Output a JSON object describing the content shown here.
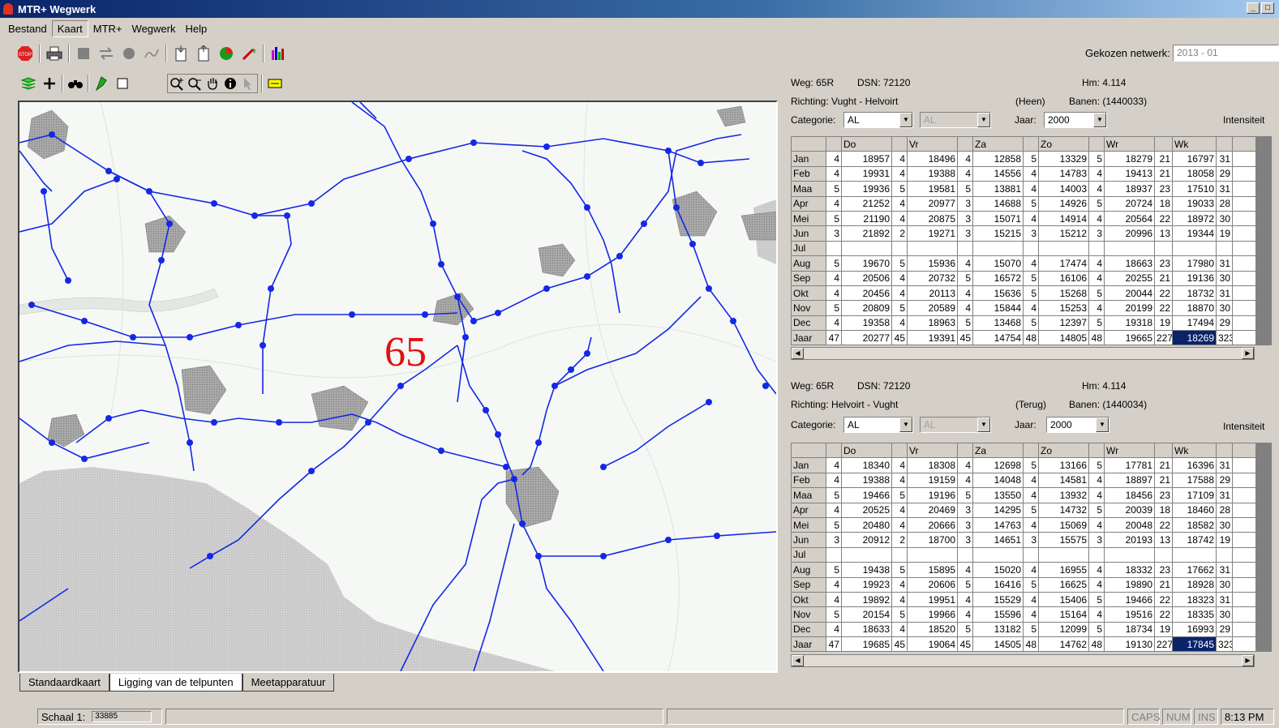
{
  "window": {
    "title": "MTR+ Wegwerk",
    "minimize": "_",
    "restore": "□"
  },
  "menu": [
    "Bestand",
    "Kaart",
    "MTR+",
    "Wegwerk",
    "Help"
  ],
  "toolbar_icons": [
    "stop-icon",
    "print-icon",
    "square-icon",
    "transfer-icon",
    "circle-icon",
    "line-icon",
    "document-in-icon",
    "document-out-icon",
    "pie-chart-icon",
    "wand-icon",
    "bar-chart-icon"
  ],
  "network": {
    "label": "Gekozen netwerk:",
    "value": "2013 - 01"
  },
  "map": {
    "road_label": "65",
    "colors": {
      "road": "#1428e6",
      "town": "#9a9a9a",
      "water": "#e8ece8",
      "region": "#c8c8c8"
    }
  },
  "map_tabs": [
    "Standaardkaart",
    "Ligging van de telpunten",
    "Meetapparatuur"
  ],
  "panel_top": {
    "weg": "Weg: 65R",
    "dsn": "DSN: 72120",
    "hm": "Hm: 4.114",
    "richting": "Richting: Vught - Helvoirt",
    "dir": "(Heen)",
    "banen": "Banen: (1440033)",
    "categorie_label": "Categorie:",
    "categorie": "AL",
    "categorie2": "AL",
    "jaar_label": "Jaar:",
    "jaar": "2000",
    "intensiteit": "Intensiteit",
    "columns": [
      "Do",
      "Vr",
      "Za",
      "Zo",
      "Wr",
      "Wk"
    ],
    "rows": [
      [
        "Jan",
        "4",
        "18957",
        "4",
        "18496",
        "4",
        "12858",
        "5",
        "13329",
        "5",
        "18279",
        "21",
        "16797",
        "31"
      ],
      [
        "Feb",
        "4",
        "19931",
        "4",
        "19388",
        "4",
        "14556",
        "4",
        "14783",
        "4",
        "19413",
        "21",
        "18058",
        "29"
      ],
      [
        "Maa",
        "5",
        "19936",
        "5",
        "19581",
        "5",
        "13881",
        "4",
        "14003",
        "4",
        "18937",
        "23",
        "17510",
        "31"
      ],
      [
        "Apr",
        "4",
        "21252",
        "4",
        "20977",
        "3",
        "14688",
        "5",
        "14926",
        "5",
        "20724",
        "18",
        "19033",
        "28"
      ],
      [
        "Mei",
        "5",
        "21190",
        "4",
        "20875",
        "3",
        "15071",
        "4",
        "14914",
        "4",
        "20564",
        "22",
        "18972",
        "30"
      ],
      [
        "Jun",
        "3",
        "21892",
        "2",
        "19271",
        "3",
        "15215",
        "3",
        "15212",
        "3",
        "20996",
        "13",
        "19344",
        "19"
      ],
      [
        "Jul",
        "",
        "",
        "",
        "",
        "",
        "",
        "",
        "",
        "",
        "",
        "",
        "",
        ""
      ],
      [
        "Aug",
        "5",
        "19670",
        "5",
        "15936",
        "4",
        "15070",
        "4",
        "17474",
        "4",
        "18663",
        "23",
        "17980",
        "31"
      ],
      [
        "Sep",
        "4",
        "20506",
        "4",
        "20732",
        "5",
        "16572",
        "5",
        "16106",
        "4",
        "20255",
        "21",
        "19136",
        "30"
      ],
      [
        "Okt",
        "4",
        "20456",
        "4",
        "20113",
        "4",
        "15636",
        "5",
        "15268",
        "5",
        "20044",
        "22",
        "18732",
        "31"
      ],
      [
        "Nov",
        "5",
        "20809",
        "5",
        "20589",
        "4",
        "15844",
        "4",
        "15253",
        "4",
        "20199",
        "22",
        "18870",
        "30"
      ],
      [
        "Dec",
        "4",
        "19358",
        "4",
        "18963",
        "5",
        "13468",
        "5",
        "12397",
        "5",
        "19318",
        "19",
        "17494",
        "29"
      ],
      [
        "Jaar",
        "47",
        "20277",
        "45",
        "19391",
        "45",
        "14754",
        "48",
        "14805",
        "48",
        "19665",
        "227",
        "18269",
        "323"
      ]
    ]
  },
  "panel_bottom": {
    "weg": "Weg: 65R",
    "dsn": "DSN: 72120",
    "hm": "Hm: 4.114",
    "richting": "Richting: Helvoirt - Vught",
    "dir": "(Terug)",
    "banen": "Banen: (1440034)",
    "categorie_label": "Categorie:",
    "categorie": "AL",
    "categorie2": "AL",
    "jaar_label": "Jaar:",
    "jaar": "2000",
    "intensiteit": "Intensiteit",
    "columns": [
      "Do",
      "Vr",
      "Za",
      "Zo",
      "Wr",
      "Wk"
    ],
    "rows": [
      [
        "Jan",
        "4",
        "18340",
        "4",
        "18308",
        "4",
        "12698",
        "5",
        "13166",
        "5",
        "17781",
        "21",
        "16396",
        "31"
      ],
      [
        "Feb",
        "4",
        "19388",
        "4",
        "19159",
        "4",
        "14048",
        "4",
        "14581",
        "4",
        "18897",
        "21",
        "17588",
        "29"
      ],
      [
        "Maa",
        "5",
        "19466",
        "5",
        "19196",
        "5",
        "13550",
        "4",
        "13932",
        "4",
        "18456",
        "23",
        "17109",
        "31"
      ],
      [
        "Apr",
        "4",
        "20525",
        "4",
        "20469",
        "3",
        "14295",
        "5",
        "14732",
        "5",
        "20039",
        "18",
        "18460",
        "28"
      ],
      [
        "Mei",
        "5",
        "20480",
        "4",
        "20666",
        "3",
        "14763",
        "4",
        "15069",
        "4",
        "20048",
        "22",
        "18582",
        "30"
      ],
      [
        "Jun",
        "3",
        "20912",
        "2",
        "18700",
        "3",
        "14651",
        "3",
        "15575",
        "3",
        "20193",
        "13",
        "18742",
        "19"
      ],
      [
        "Jul",
        "",
        "",
        "",
        "",
        "",
        "",
        "",
        "",
        "",
        "",
        "",
        "",
        ""
      ],
      [
        "Aug",
        "5",
        "19438",
        "5",
        "15895",
        "4",
        "15020",
        "4",
        "16955",
        "4",
        "18332",
        "23",
        "17662",
        "31"
      ],
      [
        "Sep",
        "4",
        "19923",
        "4",
        "20606",
        "5",
        "16416",
        "5",
        "16625",
        "4",
        "19890",
        "21",
        "18928",
        "30"
      ],
      [
        "Okt",
        "4",
        "19892",
        "4",
        "19951",
        "4",
        "15529",
        "4",
        "15406",
        "5",
        "19466",
        "22",
        "18323",
        "31"
      ],
      [
        "Nov",
        "5",
        "20154",
        "5",
        "19966",
        "4",
        "15596",
        "4",
        "15164",
        "4",
        "19516",
        "22",
        "18335",
        "30"
      ],
      [
        "Dec",
        "4",
        "18633",
        "4",
        "18520",
        "5",
        "13182",
        "5",
        "12099",
        "5",
        "18734",
        "19",
        "16993",
        "29"
      ],
      [
        "Jaar",
        "47",
        "19685",
        "45",
        "19064",
        "45",
        "14505",
        "48",
        "14762",
        "48",
        "19130",
        "227",
        "17845",
        "323"
      ]
    ]
  },
  "status": {
    "schaal_label": "Schaal 1:",
    "schaal": "33885",
    "caps": "CAPS",
    "num": "NUM",
    "ins": "INS",
    "time": "8:13 PM"
  }
}
